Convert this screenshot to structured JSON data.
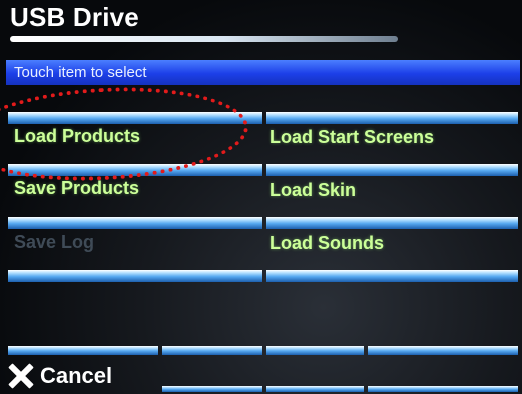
{
  "header": {
    "title": "USB Drive"
  },
  "banner": {
    "text": "Touch item to select"
  },
  "menu": {
    "load_products": "Load Products",
    "save_products": "Save Products",
    "save_log": "Save Log",
    "load_start_screens": "Load Start Screens",
    "load_skin": "Load Skin",
    "load_sounds": "Load Sounds"
  },
  "footer": {
    "cancel_label": "Cancel"
  },
  "colors": {
    "accent": "#1c3fe8",
    "item_text": "#ccff99",
    "disabled_text": "#3f4b57",
    "annotation": "#e21b1b"
  }
}
